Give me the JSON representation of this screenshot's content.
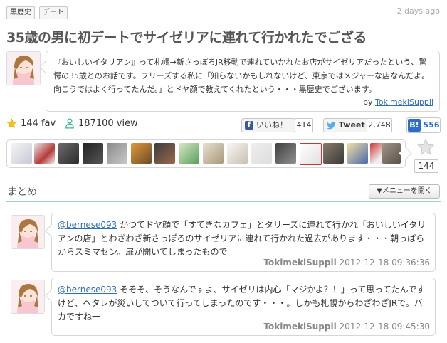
{
  "tags": [
    "黒歴史",
    "デート"
  ],
  "posted_ago": "2 days ago",
  "title": "35歳の男に初デートでサイゼリアに連れて行かれたでござる",
  "description": "『おいしいイタリアン』って札幌→新さっぽろJR移動で連れていかれたお店がサイゼリアだったという、驚愕の35歳とのお話です。フリーズする私に「知らないかもしれないけど、東京ではメジャーな店なんだよ。向こうではよく行ってたんだ。」とドヤ顔で教えてくれたという・・・黒歴史でございます。",
  "by_label": "by",
  "author": "TokimekiSuppli",
  "stats": {
    "fav": "144 fav",
    "views": "187100 view"
  },
  "share": {
    "like_label": "いいね！",
    "like_count": "414",
    "tweet_label": "Tweet",
    "tweet_count": "2,748",
    "hatena_count": "556"
  },
  "fav_count": "144",
  "section_title": "まとめ",
  "menu_button": "▼メニューを開く",
  "tweets": [
    {
      "mention": "@bernese093",
      "text": " かつてドヤ顔で「すてきなカフェ」とタリーズに連れて行かれ「おいしいイタリアンの店」とわざわざ新さっぽろのサイゼリアに連れて行かれた過去があります・・・朝っぱらからスミマセン。扉が開いてしまったもので",
      "user": "TokimekiSuppli",
      "time": "2012-12-18 09:36:36"
    },
    {
      "mention": "@bernese093",
      "text": " そそそ、そうなんですよ、サイゼリは内心「マジかよ？！」って思ってたんですけど、ヘタレが災いしてついて行ってしまったのです・・・。しかも札幌からわざわざJRで。バカですね一",
      "user": "TokimekiSuppli",
      "time": "2012-12-18 09:45:30"
    }
  ],
  "colors": {
    "accent": "#2f6fb5",
    "divider": "#9fd3c7",
    "star": "#f3c21b"
  }
}
